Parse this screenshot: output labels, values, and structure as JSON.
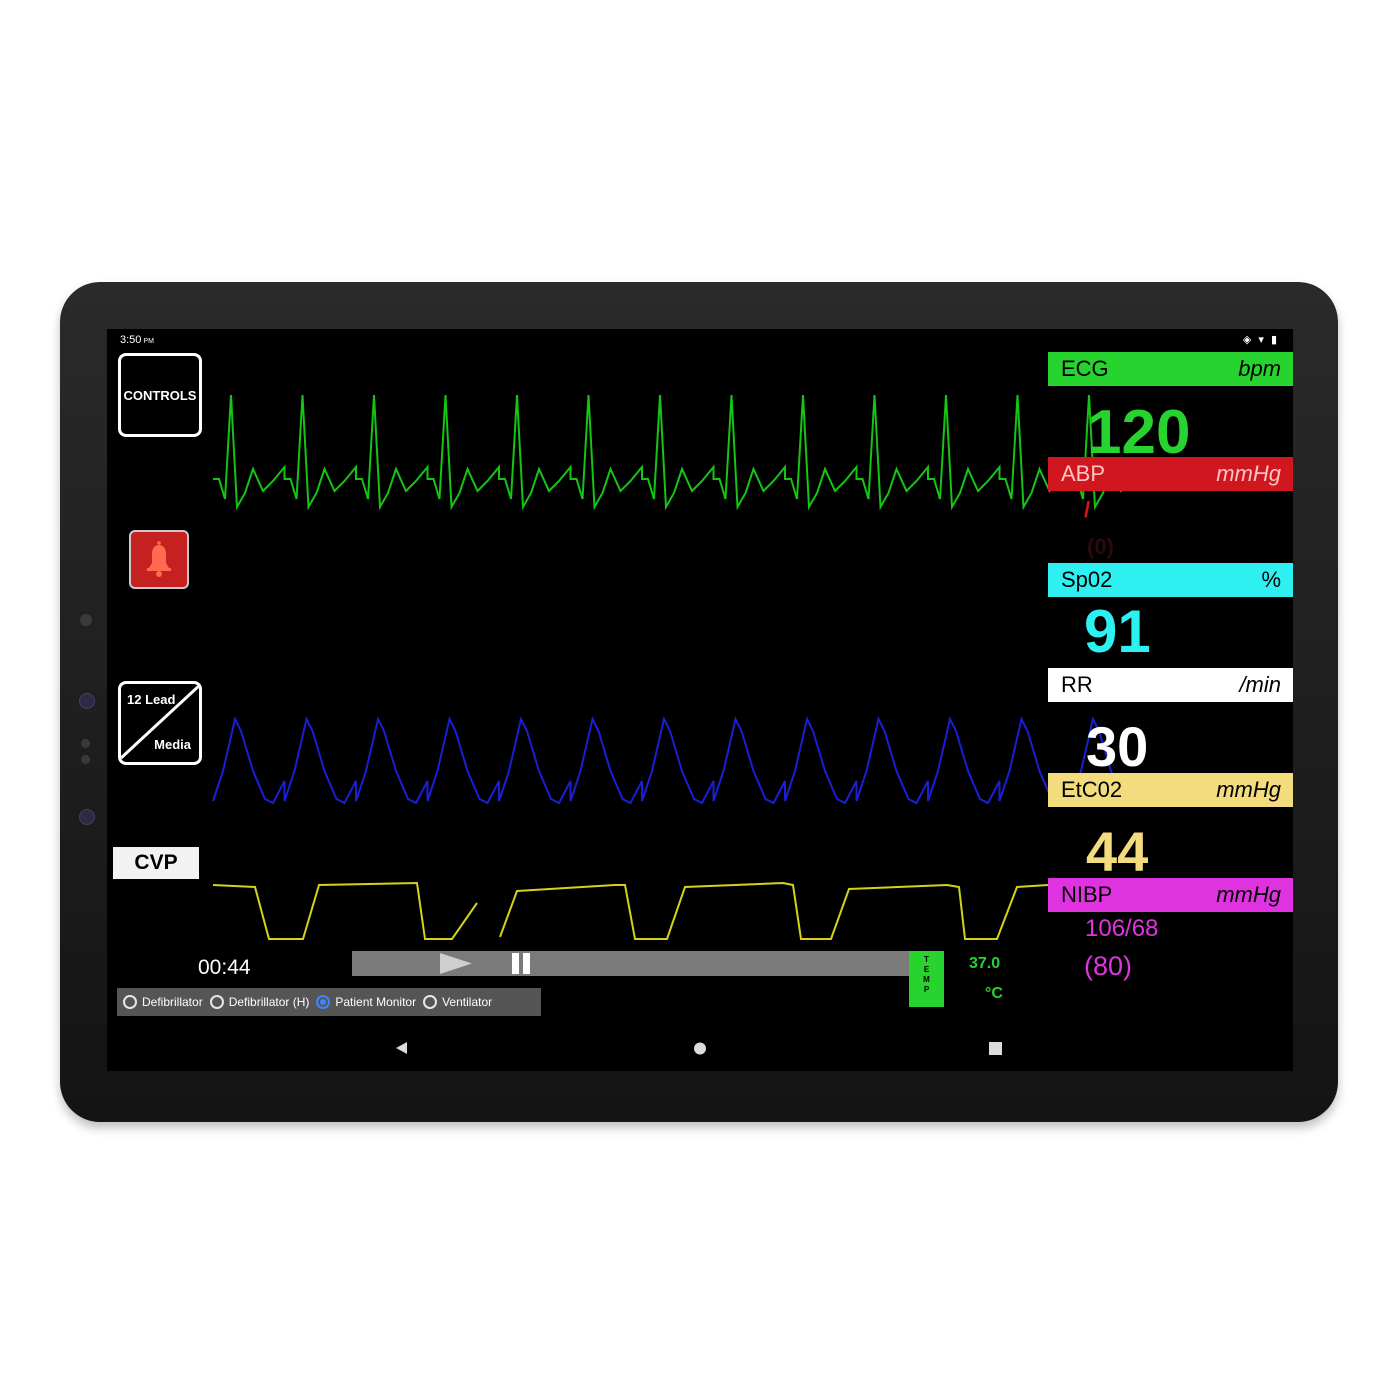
{
  "status_bar": {
    "time": "3:50",
    "ampm": "PM",
    "icons": [
      "vibrate-icon",
      "wifi-icon",
      "battery-icon"
    ]
  },
  "sidebar": {
    "controls_label": "CONTROLS",
    "lead_top": "12 Lead",
    "lead_bottom": "Media",
    "cvp_label": "CVP"
  },
  "playback": {
    "elapsed": "00:44",
    "play_icon": "play-icon",
    "pause_icon": "pause-icon",
    "temp_button": "TEMP"
  },
  "temperature": {
    "value": "37.0",
    "unit": "°C"
  },
  "modes": [
    {
      "label": "Defibrillator",
      "selected": false
    },
    {
      "label": "Defibrillator (H)",
      "selected": false
    },
    {
      "label": "Patient Monitor",
      "selected": true
    },
    {
      "label": "Ventilator",
      "selected": false
    }
  ],
  "vitals": {
    "ecg": {
      "name": "ECG",
      "unit": "bpm",
      "value": "120",
      "color": "#27d32e"
    },
    "abp": {
      "name": "ABP",
      "unit": "mmHg",
      "value": "/",
      "mean": "(0)",
      "color": "#d0161e"
    },
    "spo2": {
      "name": "Sp02",
      "unit": "%",
      "value": "91",
      "color": "#2ef0f0"
    },
    "rr": {
      "name": "RR",
      "unit": "/min",
      "value": "30",
      "color": "#ffffff"
    },
    "etco2": {
      "name": "EtC02",
      "unit": "mmHg",
      "value": "44",
      "color": "#f3dc7d"
    },
    "nibp": {
      "name": "NIBP",
      "unit": "mmHg",
      "value": "106/68",
      "mean": "(80)",
      "color": "#e033e0"
    }
  },
  "waveform_colors": {
    "ecg": "#14c514",
    "resp": "#1a1fd6",
    "cvp": "#d6d21a"
  },
  "navigation": {
    "back": "back-icon",
    "home": "home-icon",
    "recents": "recents-icon"
  }
}
